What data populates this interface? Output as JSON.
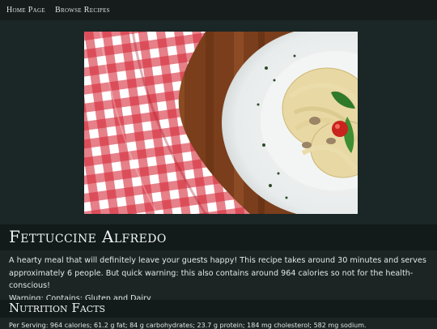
{
  "nav": {
    "home_label": "Home Page",
    "browse_label": "Browse Recipes"
  },
  "recipe": {
    "title": "Fettuccine Alfredo",
    "description": "A hearty meal that will definitely leave your guests happy! This recipe takes around 30 minutes and serves approximately 6 people. But quick warning: this also contains around 964 calories so not for the health-conscious!",
    "warning": "Warning: Contains: Gluten and Dairy"
  },
  "nutrition": {
    "heading": "Nutrition Facts",
    "per_serving": "Per Serving: 964 calories; 61.2 g fat; 84 g carbohydrates; 23.7 g protein; 184 mg cholesterol; 582 mg sodium."
  },
  "colors": {
    "background": "#1c2424",
    "bar": "#121a1a",
    "nav": "#161c1c"
  }
}
